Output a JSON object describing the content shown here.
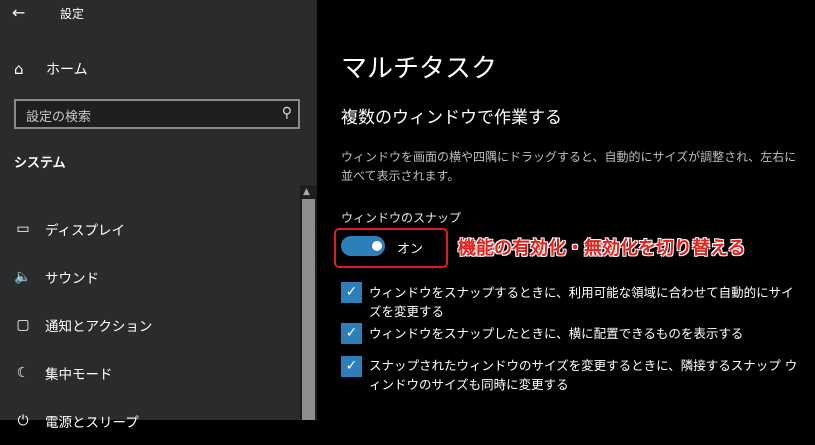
{
  "window": {
    "back_icon": "arrow-left-icon",
    "title": "設定"
  },
  "sidebar": {
    "home": {
      "label": "ホーム",
      "icon": "home-icon"
    },
    "search": {
      "placeholder": "設定の検索",
      "icon": "search-icon"
    },
    "section": "システム",
    "items": [
      {
        "label": "ディスプレイ",
        "icon": "display-icon"
      },
      {
        "label": "サウンド",
        "icon": "speaker-icon"
      },
      {
        "label": "通知とアクション",
        "icon": "notification-icon"
      },
      {
        "label": "集中モード",
        "icon": "moon-icon"
      },
      {
        "label": "電源とスリープ",
        "icon": "power-icon"
      }
    ]
  },
  "main": {
    "title": "マルチタスク",
    "subtitle": "複数のウィンドウで作業する",
    "description": "ウィンドウを画面の横や四隅にドラッグすると、自動的にサイズが調整され、左右に並べて表示されます。",
    "snap": {
      "label": "ウィンドウのスナップ",
      "toggle_state": "オン",
      "toggle_on": true
    },
    "callout": "機能の有効化・無効化を切り替える",
    "options": [
      {
        "text": "ウィンドウをスナップするときに、利用可能な領域に合わせて自動的にサイズを変更する",
        "checked": true
      },
      {
        "text": "ウィンドウをスナップしたときに、横に配置できるものを表示する",
        "checked": true
      },
      {
        "text": "スナップされたウィンドウのサイズを変更するときに、隣接するスナップ ウィンドウのサイズも同時に変更する",
        "checked": true
      }
    ]
  },
  "colors": {
    "accent": "#2d7fba",
    "callout": "#e8211c",
    "sidebar_bg": "#2b2b2b",
    "main_bg": "#000000"
  }
}
